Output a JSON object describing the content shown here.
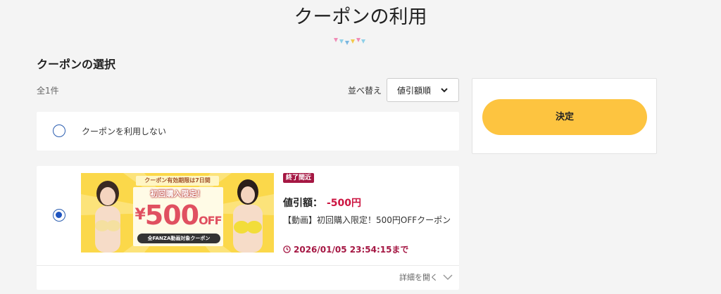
{
  "page": {
    "title": "クーポンの利用",
    "section_title": "クーポンの選択",
    "count": "全1件"
  },
  "sort": {
    "label": "並べ替え",
    "selected": "値引額順"
  },
  "options": {
    "none_label": "クーポンを利用しない"
  },
  "coupon": {
    "banner": {
      "validity": "クーポン有効期限は7日間",
      "limited": "初回購入限定！",
      "yen": "¥",
      "amount": "500",
      "off": "OFF",
      "target": "全FANZA動画対象クーポン"
    },
    "badge": "終了間近",
    "discount_label": "値引額：",
    "discount_value": "-500円",
    "name": "【動画】初回購入限定！500円OFFクーポン",
    "deadline": "2026/01/05 23:54:15まで",
    "details_label": "詳細を開く"
  },
  "side_panel": {
    "decide_label": "決定"
  },
  "colors": {
    "accent_yellow": "#fdc440",
    "badge_red": "#a51743",
    "discount_red": "#cc1541",
    "radio_blue": "#1f55c0"
  }
}
